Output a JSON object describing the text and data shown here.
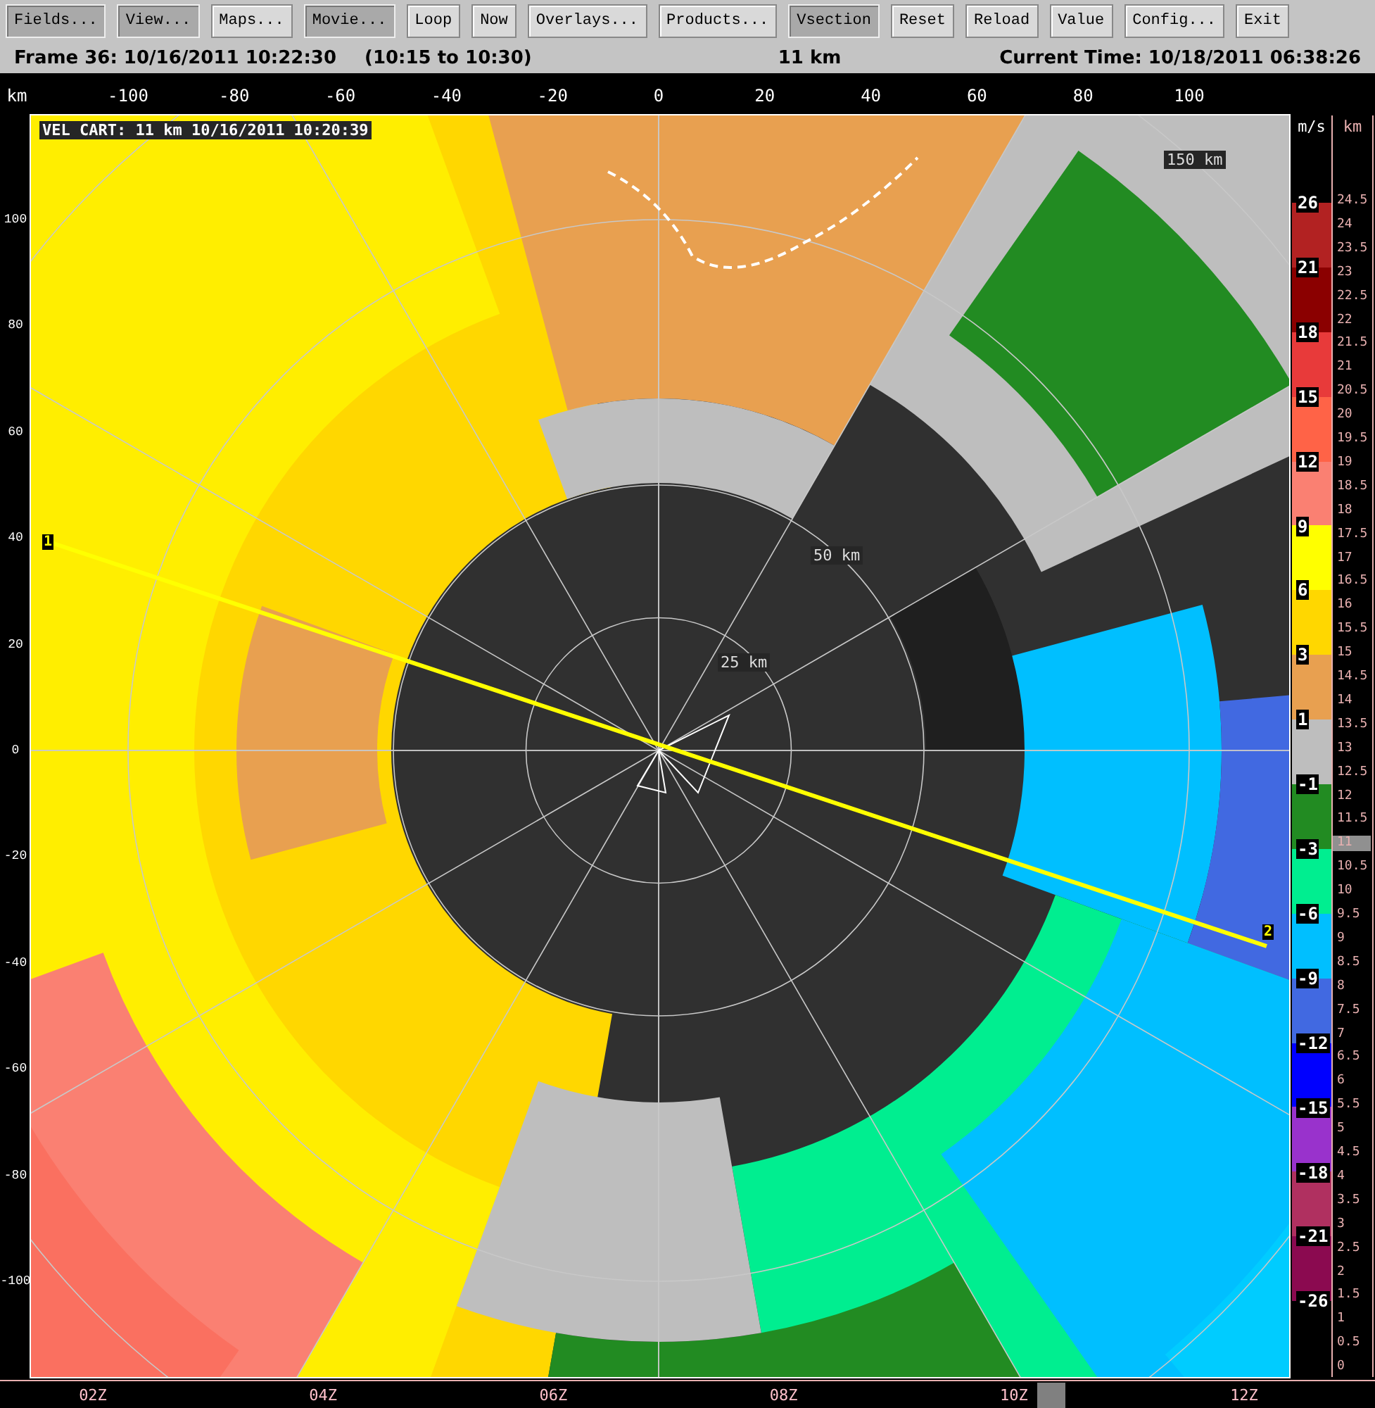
{
  "toolbar": [
    {
      "label": "Fields...",
      "selected": true
    },
    {
      "label": "View...",
      "selected": true
    },
    {
      "label": "Maps...",
      "selected": false
    },
    {
      "label": "Movie...",
      "selected": true
    },
    {
      "label": "Loop",
      "selected": false
    },
    {
      "label": "Now",
      "selected": false
    },
    {
      "label": "Overlays...",
      "selected": false
    },
    {
      "label": "Products...",
      "selected": false
    },
    {
      "label": "Vsection",
      "selected": true
    },
    {
      "label": "Reset",
      "selected": false
    },
    {
      "label": "Reload",
      "selected": false
    },
    {
      "label": "Value",
      "selected": false
    },
    {
      "label": "Config...",
      "selected": false
    },
    {
      "label": "Exit",
      "selected": false
    }
  ],
  "status_bar": {
    "frame": "Frame 36: 10/16/2011 10:22:30",
    "range": "(10:15 to 10:30)",
    "height": "11 km",
    "current_time": "Current Time: 10/18/2011 06:38:26"
  },
  "x_axis": {
    "unit": "km",
    "labels": [
      "-100",
      "-80",
      "-60",
      "-40",
      "-20",
      "0",
      "20",
      "40",
      "60",
      "80",
      "100"
    ]
  },
  "y_axis": {
    "labels": [
      "100",
      "80",
      "60",
      "40",
      "20",
      "0",
      "-20",
      "-40",
      "-60",
      "-80",
      "-100"
    ]
  },
  "plot": {
    "title": "VEL CART: 11 km 10/16/2011 10:20:39",
    "range_rings": [
      "25 km",
      "50 km",
      "150 km"
    ],
    "vsection_start": "1",
    "vsection_end": "2"
  },
  "color_scale": {
    "unit": "m/s",
    "labels": [
      "26",
      "21",
      "18",
      "15",
      "12",
      "9",
      "6",
      "3",
      "1",
      "-1",
      "-3",
      "-6",
      "-9",
      "-12",
      "-15",
      "-18",
      "-21",
      "-26"
    ],
    "bands": [
      {
        "color": "#b22222"
      },
      {
        "color": "#8b0000"
      },
      {
        "color": "#e83a3a"
      },
      {
        "color": "#ff6347"
      },
      {
        "color": "#fa8072"
      },
      {
        "color": "#ffff00"
      },
      {
        "color": "#ffd700"
      },
      {
        "color": "#e8a050"
      },
      {
        "color": "#bebebe"
      },
      {
        "color": "#228b22"
      },
      {
        "color": "#00ee90"
      },
      {
        "color": "#00bfff"
      },
      {
        "color": "#4169e1"
      },
      {
        "color": "#0000ff"
      },
      {
        "color": "#9932cc"
      },
      {
        "color": "#b03060"
      },
      {
        "color": "#8b0a50"
      }
    ]
  },
  "height_scale": {
    "unit": "km",
    "ticks": [
      {
        "label": "24.5",
        "selected": false
      },
      {
        "label": "24",
        "selected": false
      },
      {
        "label": "23.5",
        "selected": false
      },
      {
        "label": "23",
        "selected": false
      },
      {
        "label": "22.5",
        "selected": false
      },
      {
        "label": "22",
        "selected": false
      },
      {
        "label": "21.5",
        "selected": false
      },
      {
        "label": "21",
        "selected": false
      },
      {
        "label": "20.5",
        "selected": false
      },
      {
        "label": "20",
        "selected": false
      },
      {
        "label": "19.5",
        "selected": false
      },
      {
        "label": "19",
        "selected": false
      },
      {
        "label": "18.5",
        "selected": false
      },
      {
        "label": "18",
        "selected": false
      },
      {
        "label": "17.5",
        "selected": false
      },
      {
        "label": "17",
        "selected": false
      },
      {
        "label": "16.5",
        "selected": false
      },
      {
        "label": "16",
        "selected": false
      },
      {
        "label": "15.5",
        "selected": false
      },
      {
        "label": "15",
        "selected": false
      },
      {
        "label": "14.5",
        "selected": false
      },
      {
        "label": "14",
        "selected": false
      },
      {
        "label": "13.5",
        "selected": false
      },
      {
        "label": "13",
        "selected": false
      },
      {
        "label": "12.5",
        "selected": false
      },
      {
        "label": "12",
        "selected": false
      },
      {
        "label": "11.5",
        "selected": false
      },
      {
        "label": "11",
        "selected": true
      },
      {
        "label": "10.5",
        "selected": false
      },
      {
        "label": "10",
        "selected": false
      },
      {
        "label": "9.5",
        "selected": false
      },
      {
        "label": "9",
        "selected": false
      },
      {
        "label": "8.5",
        "selected": false
      },
      {
        "label": "8",
        "selected": false
      },
      {
        "label": "7.5",
        "selected": false
      },
      {
        "label": "7",
        "selected": false
      },
      {
        "label": "6.5",
        "selected": false
      },
      {
        "label": "6",
        "selected": false
      },
      {
        "label": "5.5",
        "selected": false
      },
      {
        "label": "5",
        "selected": false
      },
      {
        "label": "4.5",
        "selected": false
      },
      {
        "label": "4",
        "selected": false
      },
      {
        "label": "3.5",
        "selected": false
      },
      {
        "label": "3",
        "selected": false
      },
      {
        "label": "2.5",
        "selected": false
      },
      {
        "label": "2",
        "selected": false
      },
      {
        "label": "1.5",
        "selected": false
      },
      {
        "label": "1",
        "selected": false
      },
      {
        "label": "0.5",
        "selected": false
      },
      {
        "label": "0",
        "selected": false
      }
    ]
  },
  "time_axis": {
    "labels": [
      "02Z",
      "04Z",
      "06Z",
      "08Z",
      "10Z",
      "12Z"
    ],
    "level": 0.78
  }
}
